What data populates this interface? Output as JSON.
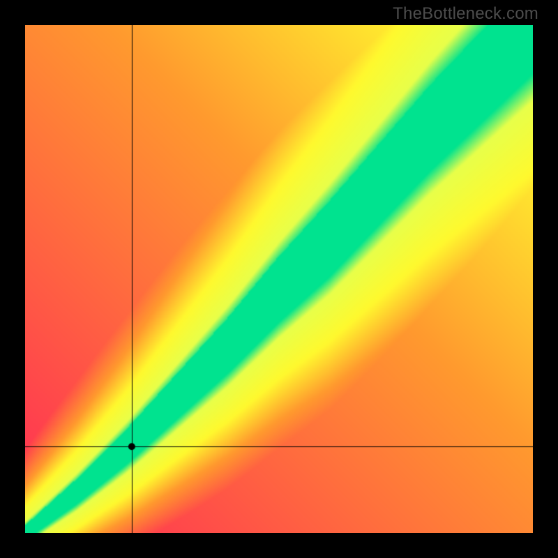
{
  "watermark": "TheBottleneck.com",
  "chart_data": {
    "type": "heatmap",
    "title": "",
    "xlabel": "",
    "ylabel": "",
    "xlim": [
      0,
      100
    ],
    "ylim": [
      0,
      100
    ],
    "crosshair": {
      "x": 21,
      "y": 17
    },
    "optimal_band": {
      "description": "Green diagonal band where performance is balanced; y ≈ 0.95*x^1.02 with ± widening width",
      "center_samples_x": [
        0,
        10,
        20,
        30,
        40,
        50,
        60,
        70,
        80,
        90,
        100
      ],
      "center_samples_y": [
        0,
        8,
        17,
        27,
        37,
        48,
        58,
        69,
        80,
        90,
        100
      ],
      "half_width_samples": [
        1.5,
        2.5,
        3.5,
        4.5,
        5.5,
        6.5,
        7.5,
        8.0,
        8.5,
        9.0,
        9.5
      ]
    },
    "color_stops": [
      {
        "t": 0.0,
        "color": "#ff2b55"
      },
      {
        "t": 0.45,
        "color": "#ff9a2e"
      },
      {
        "t": 0.7,
        "color": "#fff92e"
      },
      {
        "t": 0.92,
        "color": "#e8ff4a"
      },
      {
        "t": 1.0,
        "color": "#00e38f"
      }
    ],
    "grid": false,
    "legend": null
  },
  "layout": {
    "canvas_size": 728,
    "canvas_offset": 36
  }
}
